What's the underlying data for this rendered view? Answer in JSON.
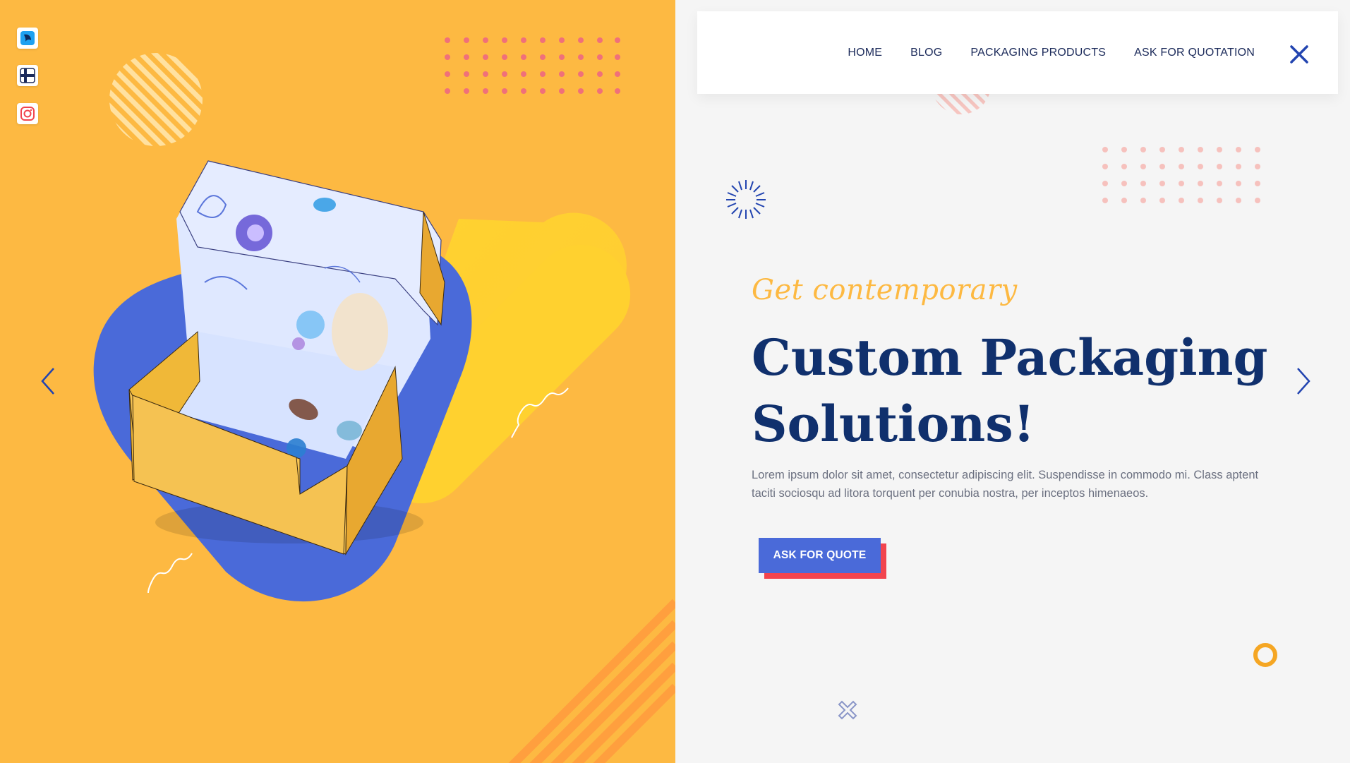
{
  "social": [
    "bird-app-icon",
    "flag-icon",
    "instagram-icon"
  ],
  "nav": {
    "items": [
      "HOME",
      "BLOG",
      "PACKAGING PRODUCTS",
      "ASK FOR QUOTATION"
    ]
  },
  "hero": {
    "eyebrow": "Get contemporary",
    "headline_line1": "Custom Packaging",
    "headline_line2": "Solutions!",
    "description": "Lorem ipsum dolor sit amet, consectetur adipiscing elit. Suspendisse in commodo mi. Class aptent taciti sociosqu ad litora torquent per conubia nostra, per inceptos himenaeos.",
    "cta_label": "ASK FOR QUOTE"
  },
  "colors": {
    "left_bg": "#fdb942",
    "blob": "#4a6ad9",
    "navy": "#10306d",
    "accent_red": "#f2444e",
    "dots": "#f0707a"
  }
}
